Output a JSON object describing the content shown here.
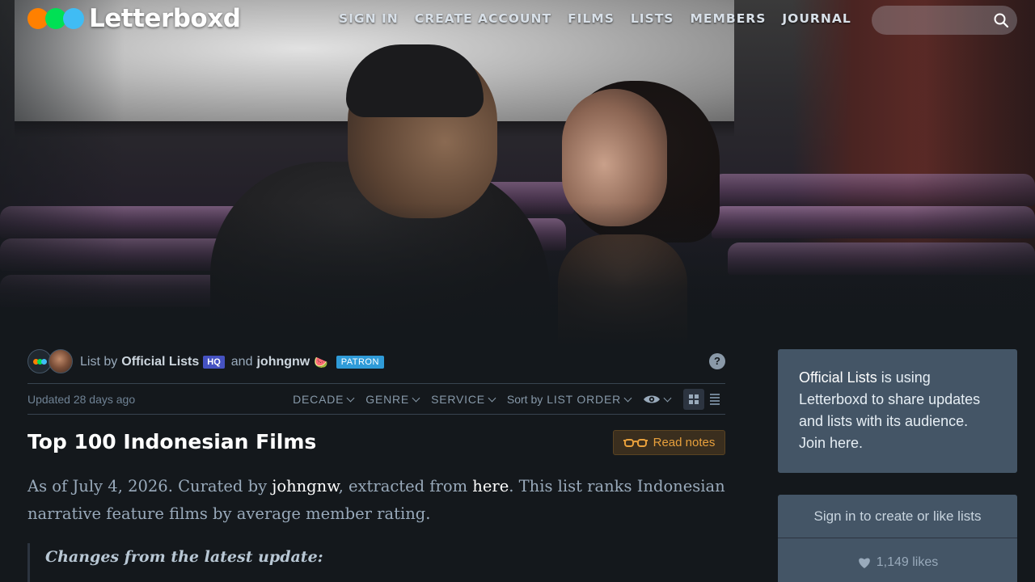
{
  "brand": {
    "name": "Letterboxd",
    "dot_colors": [
      "#ff8000",
      "#00e054",
      "#40bcf4"
    ]
  },
  "nav": {
    "items": [
      "SIGN IN",
      "CREATE ACCOUNT",
      "FILMS",
      "LISTS",
      "MEMBERS",
      "JOURNAL"
    ]
  },
  "search": {
    "placeholder": "",
    "icon": "search-icon"
  },
  "list": {
    "owner_prefix": "List by",
    "owner_name": "Official Lists",
    "owner_badge": "HQ",
    "connector": "and",
    "curator_name": "johngnw",
    "curator_icon": "watermelon-icon",
    "curator_badge": "PATRON",
    "help": "?",
    "updated": "Updated 28 days ago",
    "filters": {
      "decade": "DECADE",
      "genre": "GENRE",
      "service": "SERVICE",
      "sort_prefix": "Sort by",
      "sort_value": "LIST ORDER"
    },
    "title": "Top 100 Indonesian Films",
    "read_notes": "Read notes",
    "description": {
      "part1": "As of July 4, 2026. Curated by ",
      "link1": "johngnw",
      "part2": ", extracted from ",
      "link2": "here",
      "part3": ". This list ranks Indonesian narrative feature films by average member rating."
    },
    "notes_heading": "Changes from the latest update:"
  },
  "sidebar": {
    "promo": {
      "name": "Official Lists",
      "text": " is using Letterboxd to share updates and lists with its audience. ",
      "link": "Join here."
    },
    "signin_action": "Sign in to create or like lists",
    "likes": "1,149 likes"
  },
  "colors": {
    "background": "#14181c",
    "sidebar_panel": "#445566",
    "accent_orange": "#e8a03c",
    "hq_badge": "#4552c2",
    "patron_badge": "#2f9bd8"
  }
}
